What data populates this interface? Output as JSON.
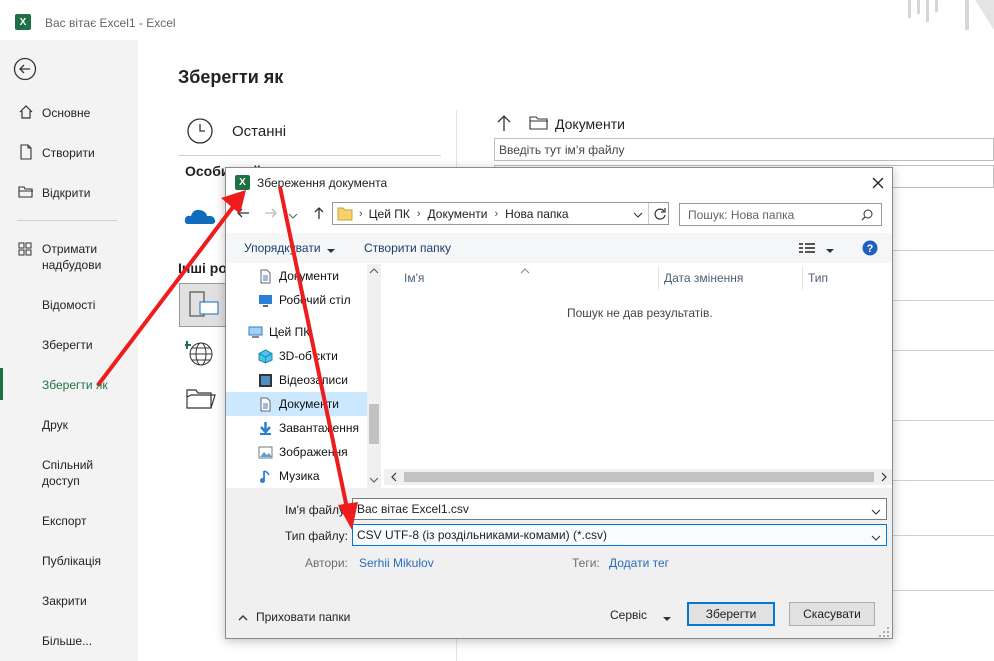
{
  "window": {
    "title": "Вас вітає Excel1  -  Excel"
  },
  "sidebar": {
    "items": [
      {
        "label": "Основне"
      },
      {
        "label": "Створити"
      },
      {
        "label": "Відкрити"
      },
      {
        "label": "Отримати надбудови"
      },
      {
        "label": "Відомості"
      },
      {
        "label": "Зберегти"
      },
      {
        "label": "Зберегти як"
      },
      {
        "label": "Друк"
      },
      {
        "label": "Спільний доступ"
      },
      {
        "label": "Експорт"
      },
      {
        "label": "Публікація"
      },
      {
        "label": "Закрити"
      },
      {
        "label": "Більше..."
      }
    ]
  },
  "backstage": {
    "title": "Зберегти як",
    "recent_label": "Останні",
    "personal_label": "Особистий",
    "other_label": "Інші розташування",
    "location_label": "Документи",
    "filename_placeholder": "Введіть тут ім’я файлу"
  },
  "dialog": {
    "title": "Збереження документа",
    "path": [
      "Цей ПК",
      "Документи",
      "Нова папка"
    ],
    "search_placeholder": "Пошук: Нова папка",
    "organize_label": "Упорядкувати",
    "new_folder_label": "Створити папку",
    "tree": [
      {
        "label": "Документи",
        "icon": "document-icon"
      },
      {
        "label": "Робочий стіл",
        "icon": "desktop-icon"
      },
      {
        "label": "Цей ПК",
        "icon": "pc-icon"
      },
      {
        "label": "3D-об'єкти",
        "icon": "cube-icon"
      },
      {
        "label": "Відеозаписи",
        "icon": "video-icon"
      },
      {
        "label": "Документи",
        "icon": "document-icon"
      },
      {
        "label": "Завантаження",
        "icon": "download-icon"
      },
      {
        "label": "Зображення",
        "icon": "image-icon"
      },
      {
        "label": "Музика",
        "icon": "music-icon"
      }
    ],
    "columns": [
      "Ім'я",
      "Дата змінення",
      "Тип"
    ],
    "empty_message": "Пошук не дав результатів.",
    "filename_label": "Ім'я файлу:",
    "filename_value": "Вас вітає Excel1.csv",
    "filetype_label": "Тип файлу:",
    "filetype_value": "CSV UTF-8 (із роздільниками-комами) (*.csv)",
    "authors_label": "Автори:",
    "authors_value": "Serhii Mikulov",
    "tags_label": "Теги:",
    "tags_value": "Додати тег",
    "hide_folders_label": "Приховати папки",
    "tools_label": "Сервіс",
    "save_label": "Зберегти",
    "cancel_label": "Скасувати"
  },
  "colors": {
    "excel_green": "#1e7145",
    "arrow_red": "#ee1c1c",
    "selection_blue": "#cce8ff",
    "link_blue": "#2a6bbd"
  }
}
